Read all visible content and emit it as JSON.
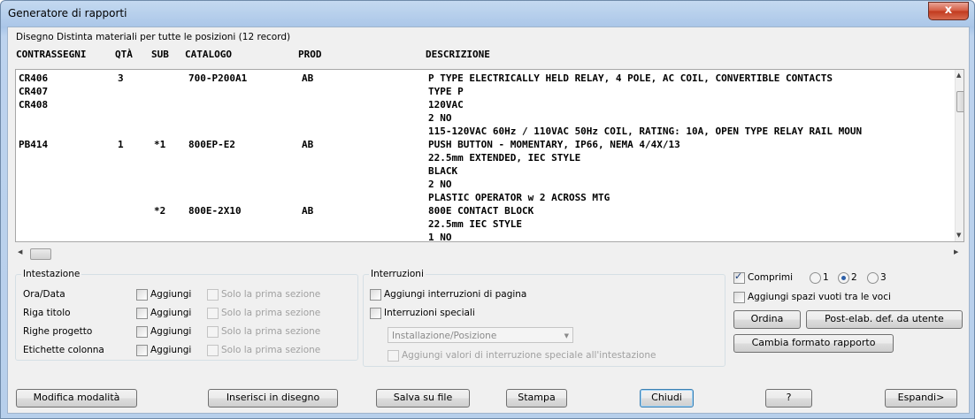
{
  "window": {
    "title": "Generatore di rapporti",
    "close_glyph": "x"
  },
  "report": {
    "info": "Disegno Distinta materiali per tutte le posizioni (12 record)",
    "columns": [
      "CONTRASSEGNI",
      "QTÀ",
      "SUB",
      "CATALOGO",
      "PROD",
      "DESCRIZIONE"
    ],
    "rows": [
      [
        "CR406",
        "3",
        "",
        "700-P200A1",
        "AB",
        "P TYPE ELECTRICALLY HELD RELAY, 4 POLE, AC COIL, CONVERTIBLE CONTACTS"
      ],
      [
        "CR407",
        "",
        "",
        "",
        "",
        "TYPE P"
      ],
      [
        "CR408",
        "",
        "",
        "",
        "",
        "120VAC"
      ],
      [
        "",
        "",
        "",
        "",
        "",
        "2 NO"
      ],
      [
        "",
        "",
        "",
        "",
        "",
        "115-120VAC 60Hz / 110VAC 50Hz COIL, RATING: 10A, OPEN TYPE RELAY RAIL MOUN"
      ],
      [
        "PB414",
        "1",
        "*1",
        "800EP-E2",
        "AB",
        "PUSH BUTTON - MOMENTARY, IP66, NEMA 4/4X/13"
      ],
      [
        "",
        "",
        "",
        "",
        "",
        "22.5mm EXTENDED, IEC STYLE"
      ],
      [
        "",
        "",
        "",
        "",
        "",
        "BLACK"
      ],
      [
        "",
        "",
        "",
        "",
        "",
        "2 NO"
      ],
      [
        "",
        "",
        "",
        "",
        "",
        "PLASTIC OPERATOR w 2 ACROSS MTG"
      ],
      [
        "",
        "",
        "*2",
        "800E-2X10",
        "AB",
        "800E CONTACT BLOCK"
      ],
      [
        "",
        "",
        "",
        "",
        "",
        "22.5mm IEC STYLE"
      ],
      [
        "",
        "",
        "",
        "",
        "",
        "1 NO"
      ]
    ]
  },
  "intestazione": {
    "title": "Intestazione",
    "items": [
      {
        "label": "Ora/Data",
        "add": "Aggiungi",
        "first": "Solo la prima sezione"
      },
      {
        "label": "Riga titolo",
        "add": "Aggiungi",
        "first": "Solo la prima sezione"
      },
      {
        "label": "Righe progetto",
        "add": "Aggiungi",
        "first": "Solo la prima sezione"
      },
      {
        "label": "Etichette colonna",
        "add": "Aggiungi",
        "first": "Solo la prima sezione"
      }
    ]
  },
  "interruzioni": {
    "title": "Interruzioni",
    "page_breaks": "Aggiungi interruzioni di pagina",
    "special_breaks": "Interruzioni speciali",
    "combo_value": "Installazione/Posizione",
    "add_special_values": "Aggiungi valori di interruzione speciale all'intestazione"
  },
  "options": {
    "compress": "Comprimi",
    "compress_checked": true,
    "radios": [
      "1",
      "2",
      "3"
    ],
    "radio_selected": "2",
    "blank_lines": "Aggiungi spazi vuoti tra le voci",
    "sort_btn": "Ordina",
    "post_btn": "Post-elab. def. da utente",
    "format_btn": "Cambia formato rapporto"
  },
  "buttons": {
    "edit_mode": "Modifica modalità",
    "insert": "Inserisci in disegno",
    "save": "Salva su file",
    "print": "Stampa",
    "close": "Chiudi",
    "help": "?",
    "expand": "Espandi>"
  },
  "colors": {
    "title_bar": "#b7cfeb",
    "close_button": "#c1391d",
    "client": "#f0f0f0"
  }
}
